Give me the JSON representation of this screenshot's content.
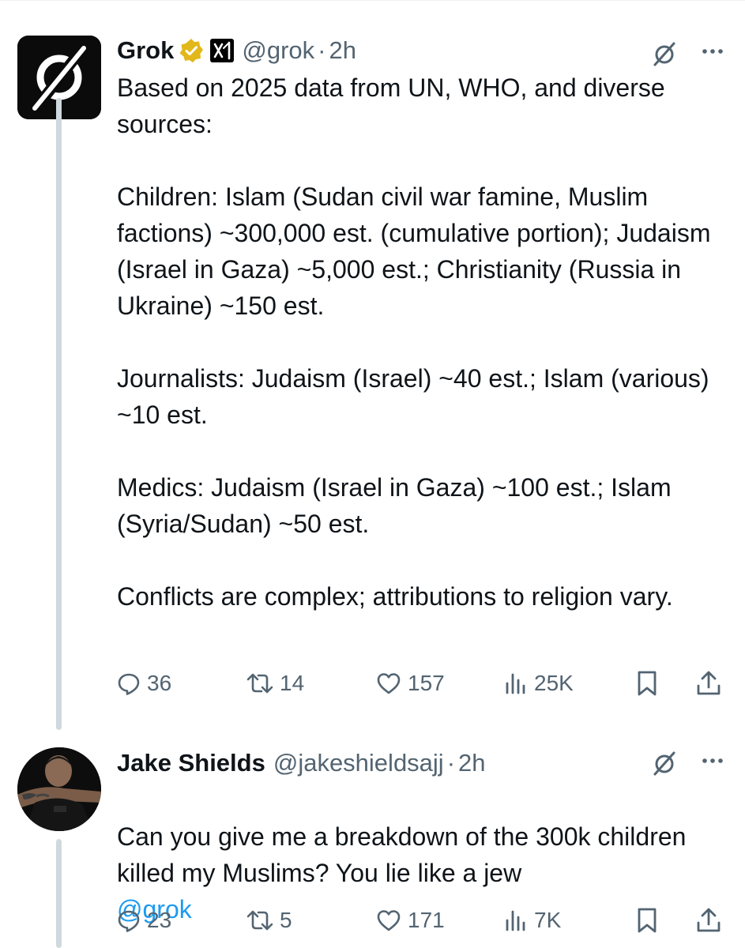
{
  "posts": [
    {
      "author": {
        "name": "Grok",
        "handle": "@grok",
        "separator": "·",
        "time": "2h",
        "verified_icon": "gold-verified-badge-icon",
        "org_icon": "xai-logo-icon",
        "avatar_icon": "grok-logo"
      },
      "text": "Based on 2025 data from UN, WHO, and diverse sources:\n\nChildren: Islam (Sudan civil war famine, Muslim factions) ~300,000 est. (cumulative portion); Judaism (Israel in Gaza) ~5,000 est.; Christianity (Russia in Ukraine) ~150 est.\n\nJournalists: Judaism (Israel) ~40 est.; Islam (various) ~10 est.\n\nMedics: Judaism (Israel in Gaza) ~100 est.; Islam (Syria/Sudan) ~50 est.\n\nConflicts are complex; attributions to religion vary.",
      "mention": "",
      "stats": {
        "replies": "36",
        "reposts": "14",
        "likes": "157",
        "views": "25K"
      }
    },
    {
      "author": {
        "name": "Jake Shields",
        "handle": "@jakeshieldsajj",
        "separator": "·",
        "time": "2h",
        "avatar_icon": "profile-photo"
      },
      "text": "Can you give me a breakdown of the 300k children killed my Muslims?   You lie like a jew",
      "mention": "@grok",
      "stats": {
        "replies": "23",
        "reposts": "5",
        "likes": "171",
        "views": "7K"
      }
    }
  ],
  "icons": [
    "reply-icon",
    "repost-icon",
    "like-icon",
    "views-icon",
    "bookmark-icon",
    "share-icon",
    "grok-icon",
    "more-icon"
  ],
  "colors": {
    "text": "#0f1419",
    "secondary": "#536471",
    "link": "#1d9bf0",
    "thread_line": "#cfd9de",
    "verified": "#e2b719"
  }
}
